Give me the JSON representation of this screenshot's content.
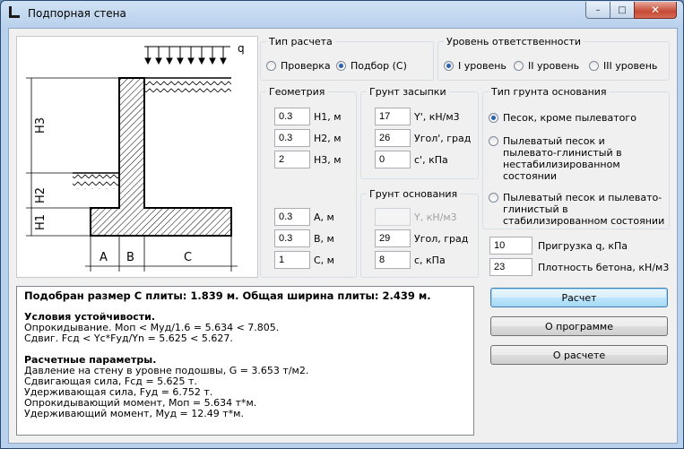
{
  "window": {
    "title": "Подпорная стена",
    "minimize": "–",
    "maximize": "□",
    "close": "✕"
  },
  "drawing": {
    "q": "q",
    "h1": "H1",
    "h2": "H2",
    "h3": "H3",
    "a": "A",
    "b": "B",
    "c": "C"
  },
  "calc_type": {
    "label": "Тип расчета",
    "options": [
      "Проверка",
      "Подбор (С)"
    ],
    "selected": "Подбор (С)"
  },
  "responsibility": {
    "label": "Уровень ответственности",
    "options": [
      "I уровень",
      "II уровень",
      "III уровень"
    ],
    "selected": "I уровень"
  },
  "geometry": {
    "label": "Геометрия",
    "h1": {
      "value": "0.3",
      "label": "H1, м"
    },
    "h2": {
      "value": "0.3",
      "label": "H2, м"
    },
    "h3": {
      "value": "2",
      "label": "H3, м"
    },
    "a": {
      "value": "0.3",
      "label": "A, м"
    },
    "b": {
      "value": "0.3",
      "label": "B, м"
    },
    "c": {
      "value": "1",
      "label": "C, м"
    }
  },
  "backfill": {
    "label": "Грунт засыпки",
    "gamma": {
      "value": "17",
      "label": "Y', кН/м3"
    },
    "angle": {
      "value": "26",
      "label": "Угол', град"
    },
    "c": {
      "value": "0",
      "label": "c', кПа"
    }
  },
  "base_soil": {
    "label": "Грунт основания",
    "gamma": {
      "value": "",
      "label": "Y, кН/м3"
    },
    "angle": {
      "value": "29",
      "label": "Угол, град"
    },
    "c": {
      "value": "8",
      "label": "c, кПа"
    }
  },
  "base_type": {
    "label": "Тип грунта основания",
    "options": [
      "Песок, кроме пылеватого",
      "Пылеватый песок и пылевато-глинистый в нестабилизированном состоянии",
      "Пылеватый песок и пылевато-глинистый в стабилизированном состоянии"
    ],
    "selected": "Песок, кроме пылеватого"
  },
  "load": {
    "value": "10",
    "label": "Пригрузка q, кПа"
  },
  "concrete": {
    "value": "23",
    "label": "Плотность бетона, кН/м3"
  },
  "output": {
    "summary": "Подобран размер С плиты: 1.839 м. Общая ширина плиты: 2.439 м.",
    "stability_title": "Условия устойчивости.",
    "overturn": "Опрокидывание. Моп  <  Муд/1.6  =  5.634  <  7.805.",
    "shear": "Сдвиг. Fсд  <  Yc*Fуд/Yn  =  5.625  <  5.627.",
    "params_title": "Расчетные параметры.",
    "pressure": "Давление на стену в уровне подошвы, G = 3.653 т/м2.",
    "shear_force": "Сдвигающая сила, Fсд = 5.625 т.",
    "hold_force": "Удерживающая сила, Fуд = 6.752 т.",
    "overturn_moment": "Опрокидывающий момент, Моп  =  5.634 т*м.",
    "hold_moment": "Удерживающий момент, Муд = 12.49 т*м."
  },
  "buttons": {
    "calculate": "Расчет",
    "about_program": "О программе",
    "about_calc": "О расчете"
  }
}
